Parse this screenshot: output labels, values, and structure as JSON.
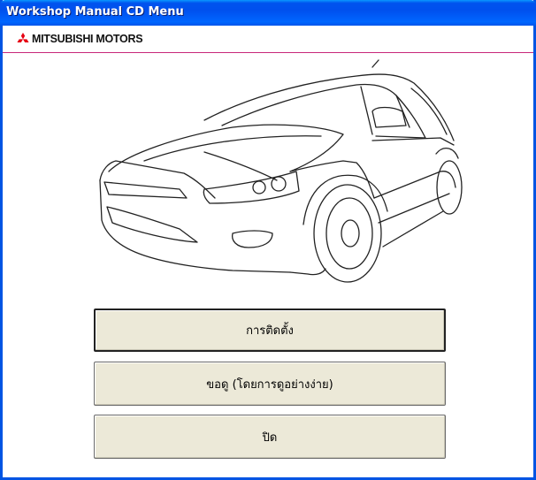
{
  "window": {
    "title": "Workshop Manual CD Menu"
  },
  "brand": {
    "name": "MITSUBISHI MOTORS",
    "logo_icon": "mitsubishi-three-diamond-icon",
    "logo_color": "#e60012",
    "accent_line_color": "#c8287a"
  },
  "hero": {
    "image": "car-line-drawing"
  },
  "buttons": {
    "install": "การติดตั้ง",
    "view_easy": "ขอดู (โดยการดูอย่างง่าย)",
    "close": "ปิด"
  },
  "colors": {
    "titlebar": "#0054e3",
    "button_face": "#ece9d8"
  }
}
